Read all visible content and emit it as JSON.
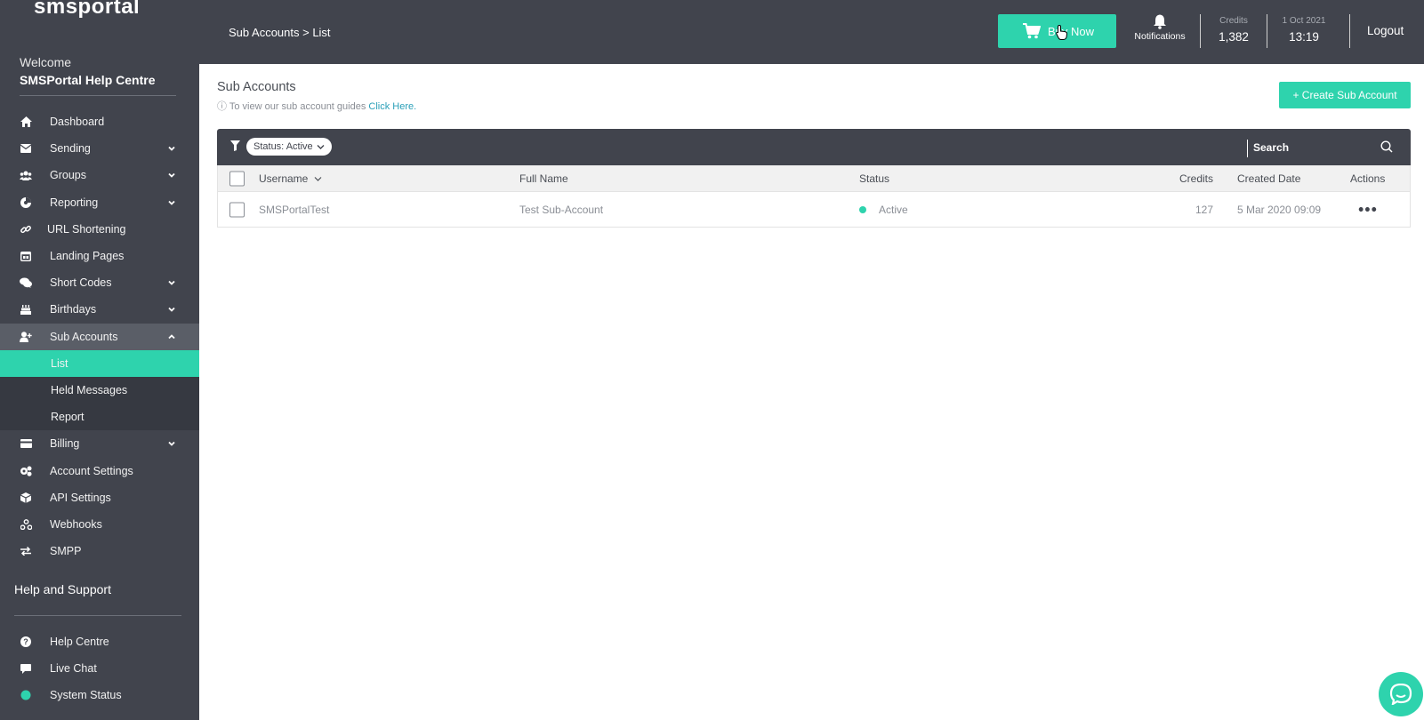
{
  "app": {
    "logo": "smsportal"
  },
  "sidebar": {
    "welcome": "Welcome",
    "user_name": "SMSPortal Help Centre",
    "items": [
      {
        "label": "Dashboard",
        "icon": "home-icon"
      },
      {
        "label": "Sending",
        "icon": "envelope-icon"
      },
      {
        "label": "Groups",
        "icon": "users-icon"
      },
      {
        "label": "Reporting",
        "icon": "chart-icon"
      },
      {
        "label": "URL Shortening",
        "icon": "link-icon"
      },
      {
        "label": "Landing Pages",
        "icon": "window-icon"
      },
      {
        "label": "Short Codes",
        "icon": "comments-icon"
      },
      {
        "label": "Birthdays",
        "icon": "cake-icon"
      },
      {
        "label": "Sub Accounts",
        "icon": "user-plus-icon"
      },
      {
        "label": "Billing",
        "icon": "card-icon"
      },
      {
        "label": "Account Settings",
        "icon": "cogs-icon"
      },
      {
        "label": "API Settings",
        "icon": "cube-icon"
      },
      {
        "label": "Webhooks",
        "icon": "webhooks-icon"
      },
      {
        "label": "SMPP",
        "icon": "exchange-icon"
      }
    ],
    "sub_items": [
      {
        "label": "List"
      },
      {
        "label": "Held Messages"
      },
      {
        "label": "Report"
      }
    ],
    "help_title": "Help and Support",
    "help_items": [
      {
        "label": "Help Centre",
        "icon": "question-icon"
      },
      {
        "label": "Live Chat",
        "icon": "chat-icon"
      },
      {
        "label": "System Status",
        "icon": "status-dot-icon"
      }
    ]
  },
  "topbar": {
    "breadcrumb": "Sub Accounts > List",
    "buy_now": "Buy Now",
    "notifications": "Notifications",
    "credits_label": "Credits",
    "credits_value": "1,382",
    "date": "1 Oct 2021",
    "time": "13:19",
    "logout": "Logout"
  },
  "main": {
    "title": "Sub Accounts",
    "guide_text": "To view our sub account guides",
    "guide_link": "Click Here.",
    "create_button": "+ Create Sub Account",
    "filter_chip": "Status: Active",
    "search_placeholder": "Search",
    "columns": {
      "username": "Username",
      "full_name": "Full Name",
      "status": "Status",
      "credits": "Credits",
      "created": "Created Date",
      "actions": "Actions"
    },
    "rows": [
      {
        "username": "SMSPortalTest",
        "full_name": "Test Sub-Account",
        "status": "Active",
        "credits": "127",
        "created": "5 Mar 2020 09:09"
      }
    ]
  },
  "colors": {
    "accent": "#2ed3ad",
    "sidebar_bg": "#41444d",
    "link": "#2a9fb8"
  }
}
